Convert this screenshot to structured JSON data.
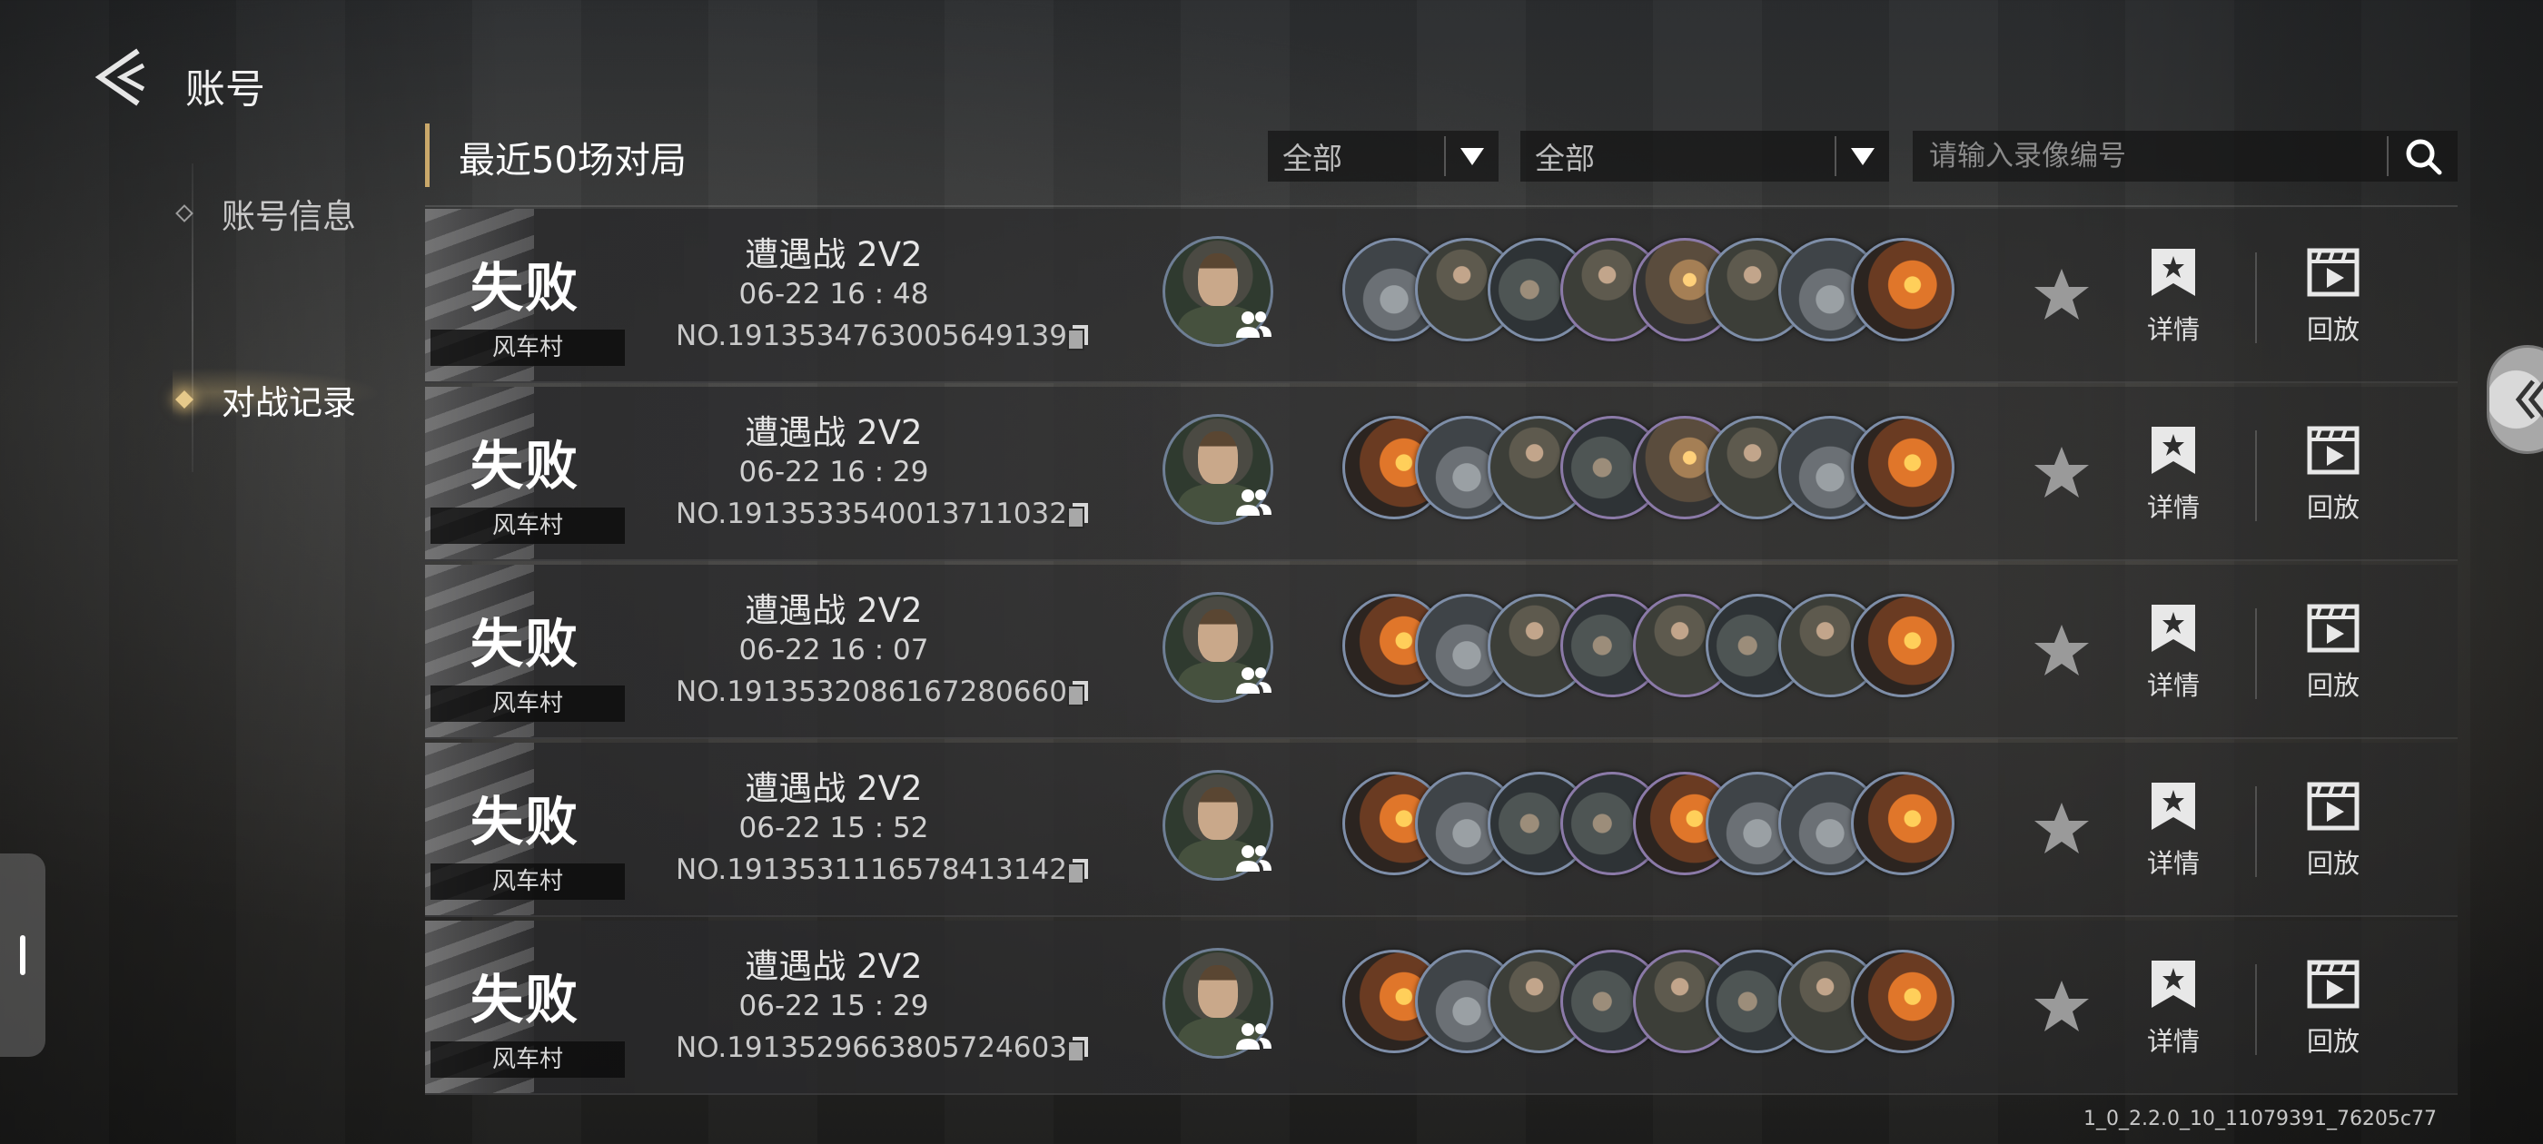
{
  "header": {
    "title": "账号"
  },
  "sidebar": {
    "items": [
      {
        "label": "账号信息",
        "active": false
      },
      {
        "label": "对战记录",
        "active": true
      }
    ]
  },
  "filters": {
    "section_title": "最近50场对局",
    "dropdown1": "全部",
    "dropdown2": "全部",
    "search_placeholder": "请输入录像编号"
  },
  "row_actions": {
    "details": "详情",
    "replay": "回放"
  },
  "matches": [
    {
      "result": "失败",
      "map": "风车村",
      "mode": "遭遇战 2V2",
      "time": "06-22  16 : 48",
      "id": "NO.1913534763005649139",
      "units": [
        "tank",
        "soldier",
        "gun",
        "soldier",
        "blast",
        "soldier",
        "tank",
        "fire"
      ]
    },
    {
      "result": "失败",
      "map": "风车村",
      "mode": "遭遇战 2V2",
      "time": "06-22  16 : 29",
      "id": "NO.1913533540013711032",
      "units": [
        "fire",
        "tank",
        "soldier",
        "gun",
        "blast",
        "soldier",
        "tank",
        "fire"
      ]
    },
    {
      "result": "失败",
      "map": "风车村",
      "mode": "遭遇战 2V2",
      "time": "06-22  16 : 07",
      "id": "NO.1913532086167280660",
      "units": [
        "fire",
        "tank",
        "soldier",
        "gun",
        "soldier",
        "gun",
        "soldier",
        "fire"
      ]
    },
    {
      "result": "失败",
      "map": "风车村",
      "mode": "遭遇战 2V2",
      "time": "06-22  15 : 52",
      "id": "NO.1913531116578413142",
      "units": [
        "fire",
        "tank",
        "gun",
        "gun",
        "fire",
        "tank",
        "tank",
        "fire"
      ]
    },
    {
      "result": "失败",
      "map": "风车村",
      "mode": "遭遇战 2V2",
      "time": "06-22  15 : 29",
      "id": "NO.1913529663805724603",
      "units": [
        "fire",
        "tank",
        "soldier",
        "gun",
        "soldier",
        "gun",
        "soldier",
        "fire"
      ]
    }
  ],
  "version": "1_0_2.2.0_10_11079391_76205c77",
  "colors": {
    "accent": "#c9a86a",
    "active_glow": "#e6c98a",
    "unit_border": "#7e8ea8"
  }
}
